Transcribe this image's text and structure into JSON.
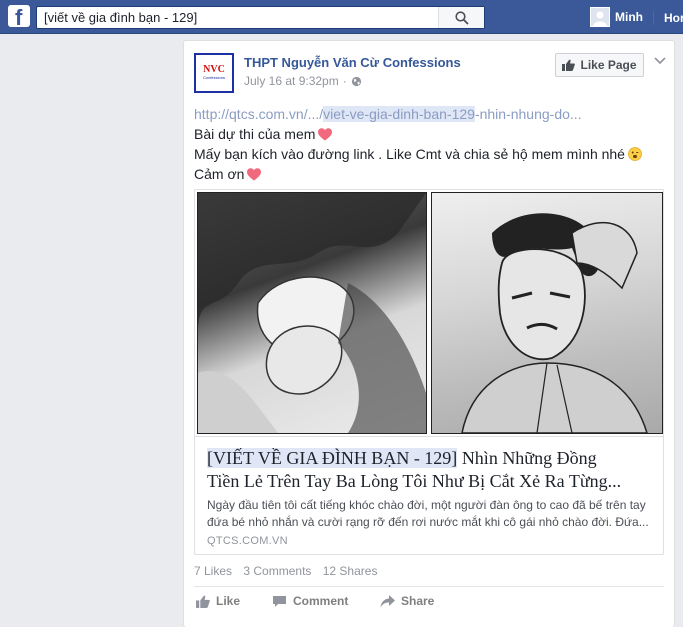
{
  "topbar": {
    "logo": "f",
    "search_value": "[viết về gia đình bạn - 129]",
    "profile_name": "Minh",
    "nav_home": "Hor"
  },
  "post": {
    "page_avatar_text": "NVC",
    "page_avatar_sub": "Confessions",
    "page_name": "THPT Nguyễn Văn Cừ Confessions",
    "timestamp": "July 16 at 9:32pm",
    "meta_separator": "·",
    "like_page_label": "Like Page",
    "link_prefix": "http://qtcs.com.vn/.../",
    "link_highlight": "viet-ve-gia-dinh-ban-129",
    "link_suffix": "-nhin-nhung-do...",
    "line2": "Bài dự thi của mem",
    "line3": "Mấy bạn kích vào đường link . Like Cmt và chia sẻ hộ mem mình nhé",
    "line4": "Cảm ơn"
  },
  "preview": {
    "title_highlight": "[VIẾT VỀ GIA ĐÌNH BẠN - 129]",
    "title_rest_line1": " Nhìn Những Đồng",
    "title_line2": "Tiền Lẻ Trên Tay Ba Lòng Tôi Như Bị Cắt Xẻ Ra Từng...",
    "desc_line1": "Ngày đầu tiên tôi cất tiếng khóc chào đời, một người đàn ông to cao đã bế trên tay",
    "desc_line2": "đứa bé nhỏ nhắn và cười rạng rỡ đến rơi nước mắt khi cô gái nhỏ chào đời. Đứa...",
    "domain": "QTCS.COM.VN"
  },
  "stats": {
    "likes": "7 Likes",
    "comments": "3 Comments",
    "shares": "12 Shares"
  },
  "actions": {
    "like": "Like",
    "comment": "Comment",
    "share": "Share"
  },
  "colors": {
    "topbar": "#3b5998",
    "link": "#365899",
    "heart": "#f0697d"
  }
}
